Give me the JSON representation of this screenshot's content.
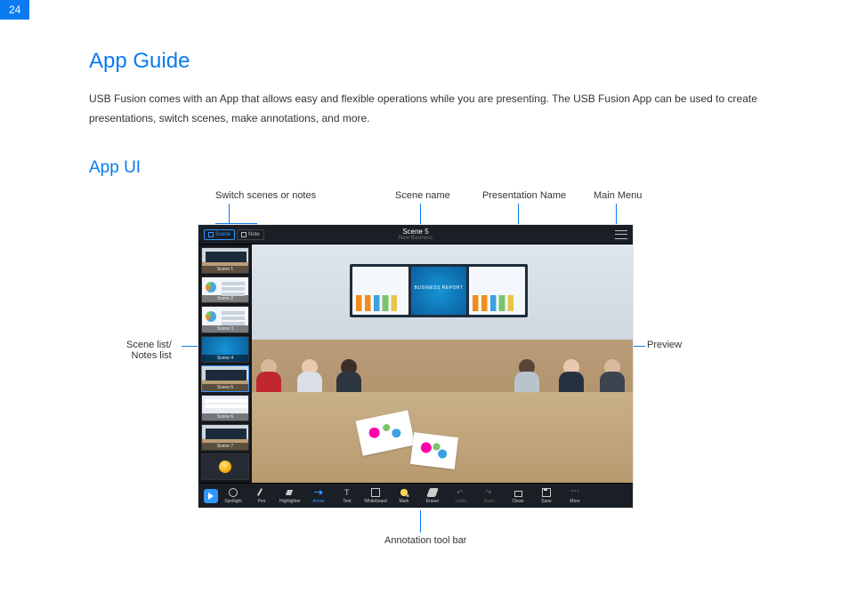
{
  "page_number": "24",
  "heading": "App Guide",
  "intro": "USB Fusion comes with an App that allows easy and flexible operations while you are presenting. The USB Fusion App can be used to create presentations, switch scenes, make annotations, and more.",
  "sub_heading": "App UI",
  "callouts": {
    "switch": "Switch scenes or notes",
    "scene": "Scene name",
    "presentation": "Presentation Name",
    "menu": "Main Menu",
    "list": "Scene list/\nNotes list",
    "preview": "Preview",
    "toolbar": "Annotation tool bar"
  },
  "app": {
    "switcher": {
      "scene": "Scene",
      "note": "Note"
    },
    "scene_name": "Scene 5",
    "presentation_name": "New Business",
    "preview_screen_text": "BUSINESS REPORT",
    "thumbs": [
      "Scene 1",
      "Scene 2",
      "Scene 3",
      "Scene 4",
      "Scene 5",
      "Scene 6",
      "Scene 7"
    ],
    "tools": {
      "spotlight": "Spotlight",
      "pen": "Pen",
      "highlighter": "Highlighter",
      "arrow": "Arrow",
      "text": "Text",
      "whiteboard": "Whiteboard",
      "mark": "Mark",
      "eraser": "Eraser",
      "undo": "Undo",
      "redo": "Redo",
      "clean": "Clean",
      "save": "Save",
      "more": "More"
    }
  }
}
